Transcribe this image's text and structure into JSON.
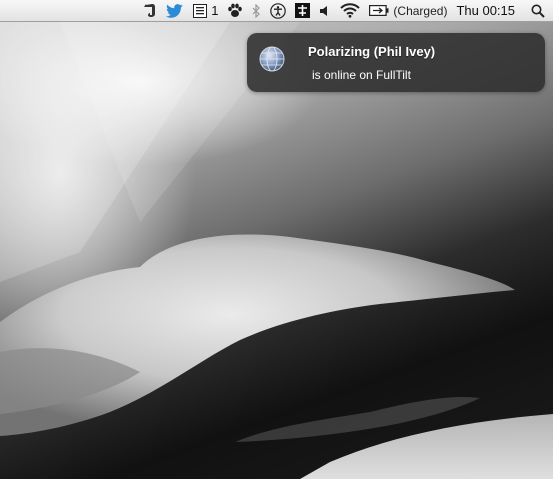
{
  "menubar": {
    "icons": [
      "evernote-icon",
      "twitter-icon",
      "notes-list-icon",
      "paw-icon",
      "bluetooth-icon",
      "accessibility-icon",
      "tool-icon",
      "volume-icon",
      "wifi-icon",
      "battery-icon",
      "spotlight-search-icon"
    ],
    "notes_count": "1",
    "battery_status": "(Charged)",
    "clock": "Thu 00:15"
  },
  "notification": {
    "title": "Polarizing (Phil Ivey)",
    "message": "is online on FullTilt",
    "icon": "globe-icon"
  },
  "colors": {
    "menubar_top": "#f7f7f7",
    "menubar_bottom": "#e3e3e3",
    "notification_bg": "#2d2d2d",
    "twitter_blue": "#2a8cd6"
  }
}
